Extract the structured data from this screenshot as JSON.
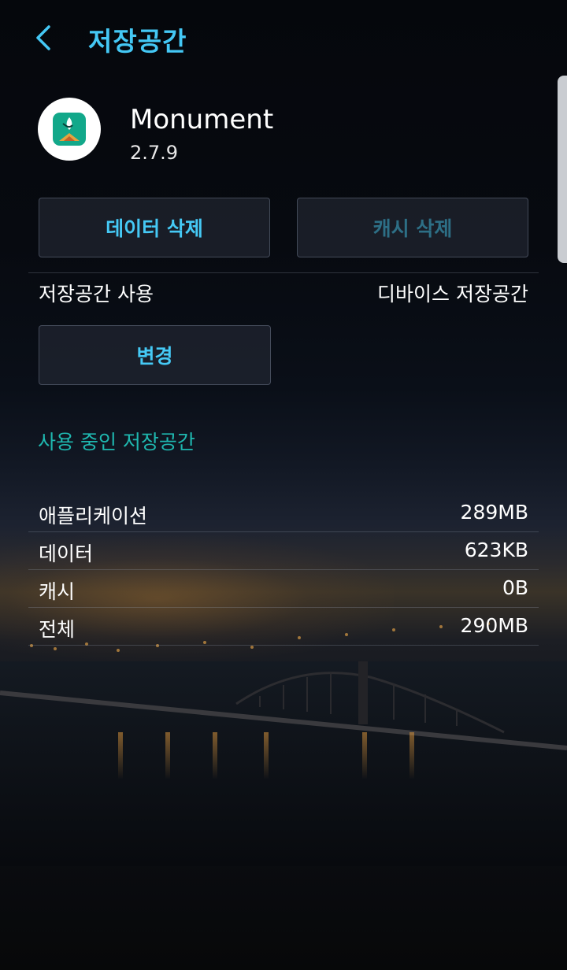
{
  "header": {
    "title": "저장공간"
  },
  "app": {
    "name": "Monument",
    "version": "2.7.9"
  },
  "buttons": {
    "clear_data": "데이터 삭제",
    "clear_cache": "캐시 삭제",
    "change": "변경"
  },
  "storage_used": {
    "label": "저장공간 사용",
    "value": "디바이스 저장공간"
  },
  "usage": {
    "section_title": "사용 중인 저장공간",
    "rows": [
      {
        "label": "애플리케이션",
        "value": "289MB"
      },
      {
        "label": "데이터",
        "value": "623KB"
      },
      {
        "label": "캐시",
        "value": "0B"
      },
      {
        "label": "전체",
        "value": "290MB"
      }
    ]
  },
  "colors": {
    "accent": "#44c8f5",
    "section_title": "#1fb8b0",
    "disabled": "#2d6f86"
  }
}
